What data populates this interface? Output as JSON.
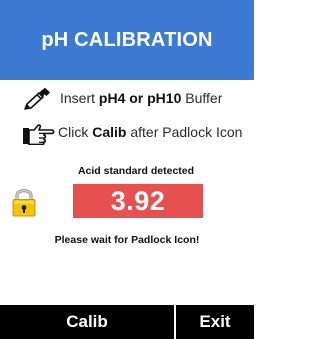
{
  "header": {
    "title": "pH CALIBRATION",
    "background": "#3d7ad4"
  },
  "instructions": [
    {
      "icon": "dropper-icon",
      "prefix": "Insert ",
      "bold": "pH4 or pH10",
      "suffix": " Buffer"
    },
    {
      "icon": "pointing-hand-icon",
      "prefix": "Click ",
      "bold": "Calib",
      "suffix": " after Padlock Icon"
    }
  ],
  "reading": {
    "label": "Acid standard detected",
    "value": "3.92",
    "box_color": "#e84f4f",
    "lock_icon": "padlock-icon",
    "lock_color": "#f5c400"
  },
  "status": {
    "message": "Please wait for Padlock Icon!"
  },
  "footer": {
    "calib_label": "Calib",
    "exit_label": "Exit"
  }
}
